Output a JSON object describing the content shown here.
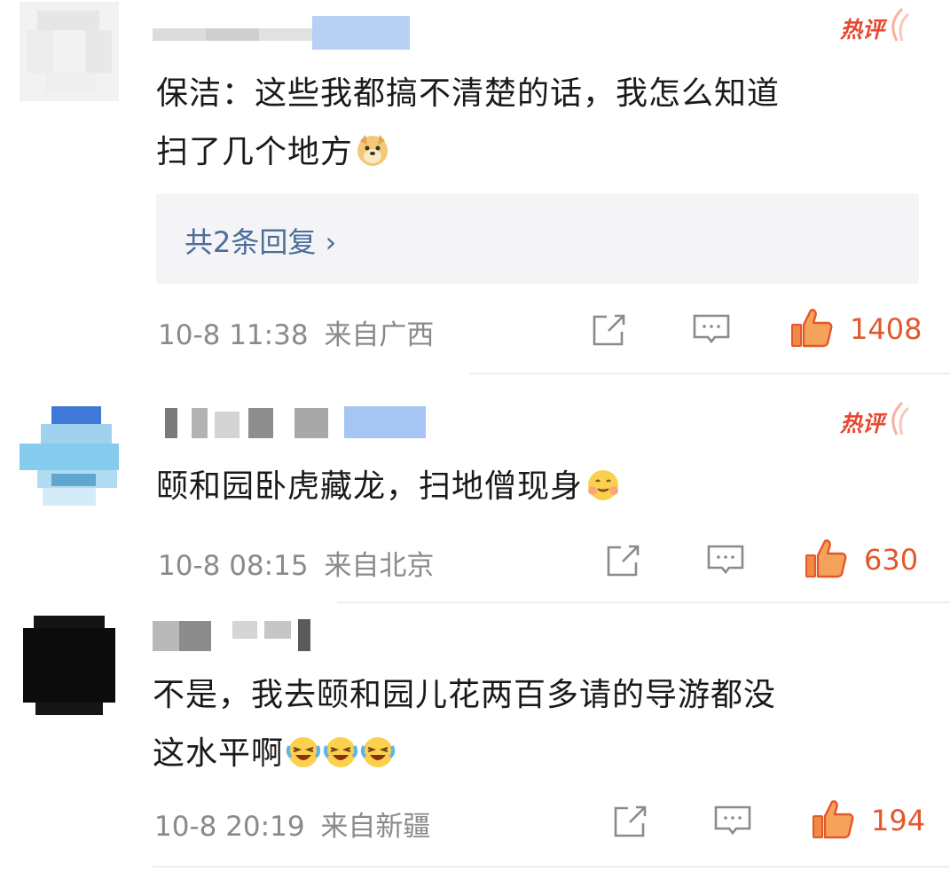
{
  "comments": [
    {
      "badge": "热评",
      "text_line1": "保洁：这些我都搞不清楚的话，我怎么知道",
      "text_line2": "扫了几个地方",
      "emoji": [
        "doge-emoji"
      ],
      "replies": "共2条回复 ›",
      "time": "10-8 11:38",
      "location": "来自广西",
      "likes": "1408"
    },
    {
      "badge": "热评",
      "text_line1": "颐和园卧虎藏龙，扫地僧现身",
      "emoji": [
        "shy-emoji"
      ],
      "time": "10-8 08:15",
      "location": "来自北京",
      "likes": "630"
    },
    {
      "text_line1": "不是，我去颐和园儿花两百多请的导游都没",
      "text_line2": "这水平啊",
      "emoji": [
        "laugh-cry-emoji",
        "laugh-cry-emoji",
        "laugh-cry-emoji"
      ],
      "time": "10-8 20:19",
      "location": "来自新疆",
      "likes": "194"
    }
  ],
  "colors": {
    "accent_like": "#e2582a",
    "hot_badge": "#e8472f",
    "reply_link": "#4a6d9a",
    "meta_gray": "#8a8a8a"
  }
}
